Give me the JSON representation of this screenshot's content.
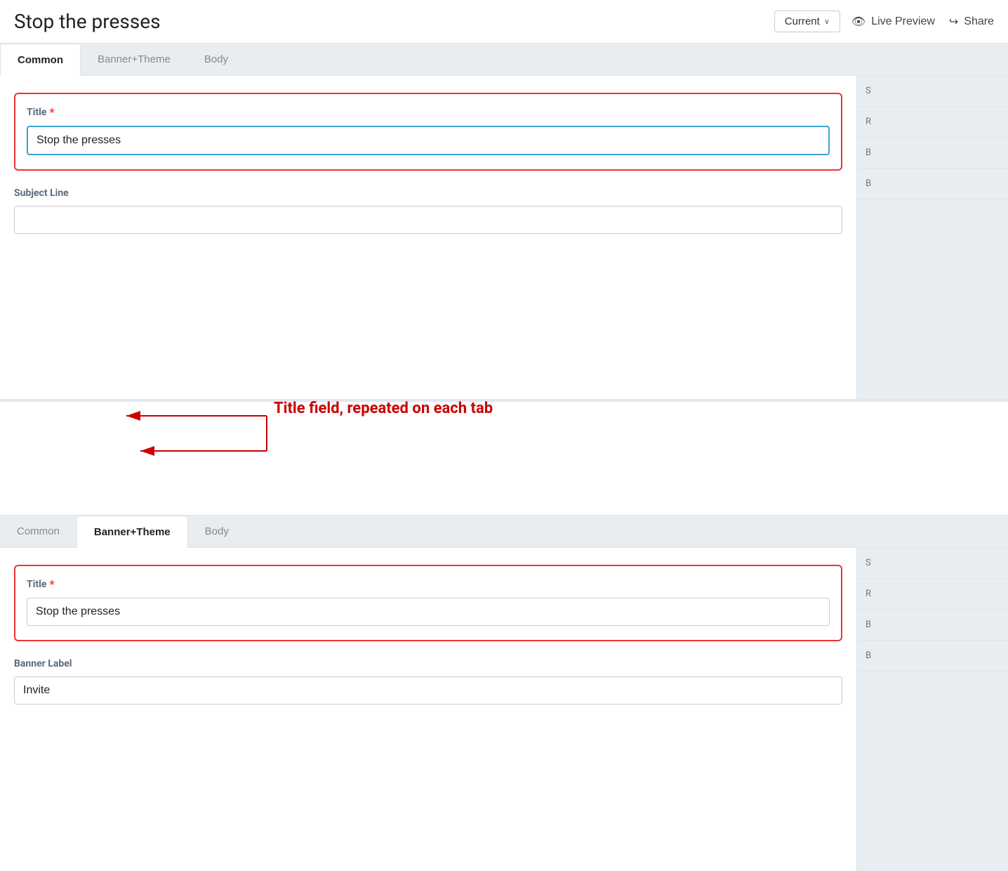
{
  "app": {
    "title": "Stop the presses"
  },
  "panel1": {
    "header": {
      "title": "Stop the presses",
      "current_label": "Current",
      "live_preview_label": "Live Preview",
      "share_label": "Share"
    },
    "tabs": [
      {
        "id": "common",
        "label": "Common",
        "active": true
      },
      {
        "id": "banner_theme",
        "label": "Banner+Theme",
        "active": false
      },
      {
        "id": "body",
        "label": "Body",
        "active": false
      }
    ],
    "title_field": {
      "label": "Title",
      "required": true,
      "value": "Stop the presses",
      "placeholder": ""
    },
    "subject_line_field": {
      "label": "Subject Line",
      "required": false,
      "value": "",
      "placeholder": ""
    }
  },
  "panel2": {
    "header": {
      "title": "Stop the presses",
      "current_label": "Current",
      "live_preview_label": "Live Preview",
      "share_label": "Share"
    },
    "tabs": [
      {
        "id": "common",
        "label": "Common",
        "active": false
      },
      {
        "id": "banner_theme",
        "label": "Banner+Theme",
        "active": true
      },
      {
        "id": "body",
        "label": "Body",
        "active": false
      }
    ],
    "title_field": {
      "label": "Title",
      "required": true,
      "value": "Stop the presses",
      "placeholder": ""
    },
    "banner_label_field": {
      "label": "Banner Label",
      "required": false,
      "value": "Invite",
      "placeholder": ""
    }
  },
  "annotation": {
    "text": "Title field, repeated on each tab"
  },
  "sidebar1": {
    "items": [
      "S",
      "R",
      "B",
      "B"
    ]
  },
  "sidebar2": {
    "items": [
      "S",
      "R",
      "B",
      "B"
    ]
  },
  "icons": {
    "eye": "👁",
    "share": "↪",
    "chevron": "∨"
  }
}
